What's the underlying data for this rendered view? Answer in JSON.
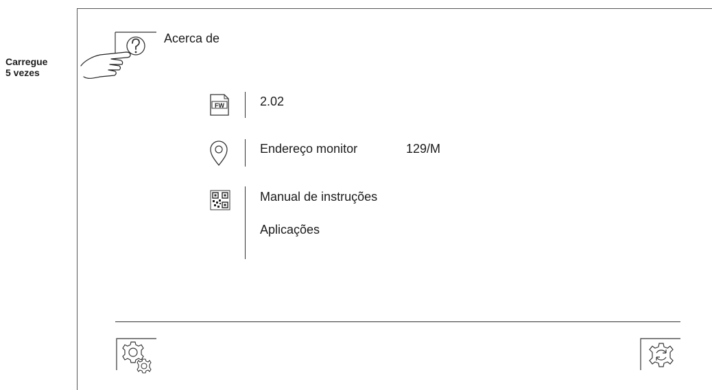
{
  "side_note": {
    "line1": "Carregue",
    "line2": "5 vezes"
  },
  "header": {
    "title": "Acerca de",
    "help_icon": "question-mark-icon",
    "pointer_icon": "pointing-hand-icon"
  },
  "info": {
    "firmware": {
      "icon": "fw-icon",
      "icon_text": "FW",
      "value": "2.02"
    },
    "address": {
      "icon": "location-pin-icon",
      "label": "Endereço monitor",
      "value": "129/M"
    },
    "links": {
      "icon": "qr-code-icon",
      "manual_label": "Manual de instruções",
      "apps_label": "Aplicações"
    }
  },
  "footer": {
    "left_icon": "settings-gear-icon",
    "right_icon": "refresh-settings-icon"
  }
}
